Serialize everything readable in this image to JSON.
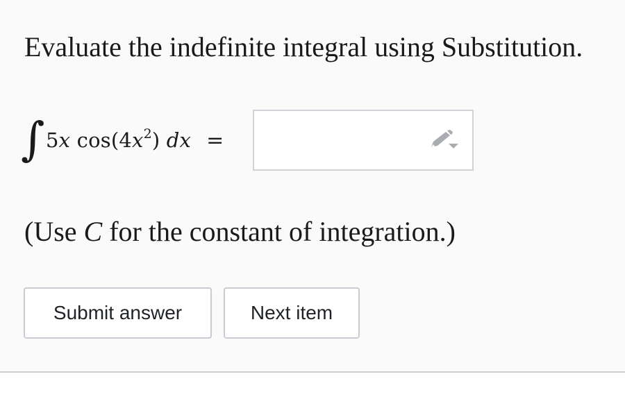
{
  "question": {
    "prompt": "Evaluate the indefinite integral using Substitution."
  },
  "expression": {
    "integral_symbol": "∫",
    "coefficient": "5",
    "var1": "x",
    "func": " cos(4",
    "var2": "x",
    "exponent": "2",
    "close": ") ",
    "differential": "dx",
    "equals": "="
  },
  "answer": {
    "value": "",
    "placeholder": ""
  },
  "icons": {
    "answer_tool": "pencil-dropdown-icon"
  },
  "note": {
    "before": "(Use ",
    "constant": "C",
    "after": " for the constant of integration.)"
  },
  "buttons": {
    "submit_label": "Submit answer",
    "next_label": "Next item"
  },
  "colors": {
    "panel_background": "#fafafa",
    "border": "#c8ccd0",
    "icon": "#a9adb1"
  }
}
